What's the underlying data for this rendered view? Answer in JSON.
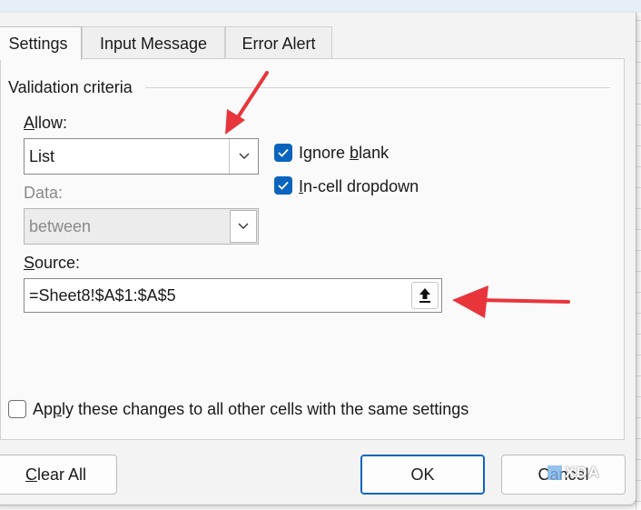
{
  "tabs": [
    {
      "label": "Settings",
      "active": true
    },
    {
      "label": "Input Message",
      "active": false
    },
    {
      "label": "Error Alert",
      "active": false
    }
  ],
  "criteria": {
    "group_title": "Validation criteria",
    "allow": {
      "accel": "A",
      "rest": "llow:",
      "value": "List"
    },
    "data": {
      "label": "Data:",
      "value": "between",
      "enabled": false
    },
    "ignore_blank": {
      "pre": "Ignore ",
      "accel": "b",
      "post": "lank",
      "checked": true
    },
    "in_cell_dropdown": {
      "accel": "I",
      "post": "n-cell dropdown",
      "checked": true
    },
    "source": {
      "accel": "S",
      "rest": "ource:",
      "value": "=Sheet8!$A$1:$A$5"
    }
  },
  "apply_all": {
    "pre": "Ap",
    "accel": "p",
    "post": "ly these changes to all other cells with the same settings",
    "checked": false
  },
  "buttons": {
    "clear_all": {
      "accel": "C",
      "rest": "lear All"
    },
    "ok": "OK",
    "cancel": "Cancel"
  },
  "watermark": "XDA",
  "colors": {
    "accent": "#0a64be",
    "annotation": "#e8353b"
  },
  "icons": {
    "dropdown": "chevron-down-icon",
    "collapse": "collapse-dialog-icon",
    "check": "checkmark-icon"
  }
}
